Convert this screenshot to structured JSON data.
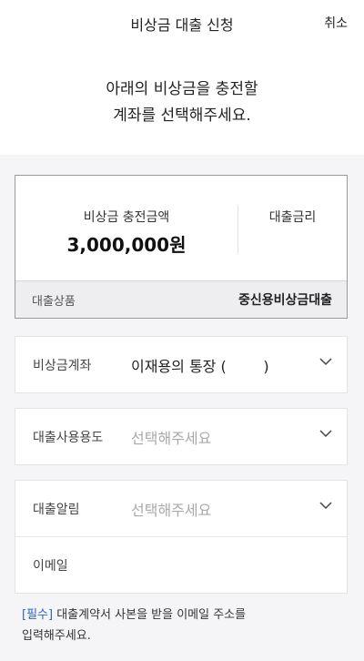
{
  "header": {
    "title": "비상금 대출 신청",
    "cancel_label": "취소"
  },
  "intro": {
    "line1": "아래의 비상금을 충전할",
    "line2": "계좌를 선택해주세요."
  },
  "summary": {
    "amount_label": "비상금 충전금액",
    "amount_value": "3,000,000원",
    "rate_label": "대출금리",
    "product_label": "대출상품",
    "product_value": "중신용비상금대출"
  },
  "fields": {
    "account": {
      "label": "비상금계좌",
      "value": "이재용의 통장 (        )"
    },
    "purpose": {
      "label": "대출사용용도",
      "placeholder": "선택해주세요"
    },
    "alert": {
      "label": "대출알림",
      "placeholder": "선택해주세요"
    },
    "email": {
      "label": "이메일"
    }
  },
  "notice": {
    "required_tag": "[필수]",
    "text_line1": " 대출계약서 사본을 받을 이메일 주소를",
    "text_line2": "입력해주세요."
  },
  "colors": {
    "accent": "#2f62c7",
    "background": "#f5f5f7",
    "placeholder": "#a9a9ad"
  }
}
